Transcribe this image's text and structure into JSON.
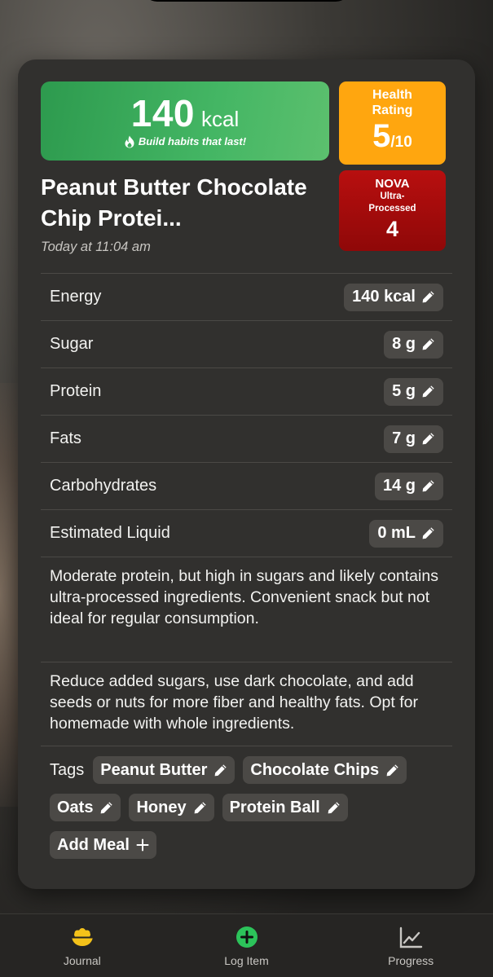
{
  "colors": {
    "kcal_green": "#3aaa5a",
    "health_orange": "#ffa60f",
    "nova_red": "#a00c0c",
    "card_bg": "#31302e",
    "pill_bg": "#4b4946",
    "journal_yellow": "#f4c21a",
    "log_green": "#2cc35a"
  },
  "summary": {
    "kcal_value": "140",
    "kcal_unit": "kcal",
    "tagline": "Build habits that last!",
    "health_title": "Health Rating",
    "health_score": "5",
    "health_denominator": "/10",
    "nova_title": "NOVA",
    "nova_subtitle": "Ultra-Processed",
    "nova_value": "4"
  },
  "food": {
    "title": "Peanut Butter Chocolate Chip Protei...",
    "timestamp": "Today at 11:04 am"
  },
  "nutrients": [
    {
      "label": "Energy",
      "value": "140 kcal"
    },
    {
      "label": "Sugar",
      "value": "8 g"
    },
    {
      "label": "Protein",
      "value": "5 g"
    },
    {
      "label": "Fats",
      "value": "7 g"
    },
    {
      "label": "Carbohydrates",
      "value": "14 g"
    },
    {
      "label": "Estimated Liquid",
      "value": "0 mL"
    }
  ],
  "analysis": "Moderate protein, but high in sugars and likely contains ultra-processed ingredients. Convenient snack but not ideal for regular consumption.",
  "suggestion": "Reduce added sugars, use dark chocolate, and add seeds or nuts for more fiber and healthy fats. Opt for homemade with whole ingredients.",
  "tags": {
    "label": "Tags",
    "items": [
      "Peanut Butter",
      "Chocolate Chips",
      "Oats",
      "Honey",
      "Protein Ball"
    ],
    "add_meal_label": "Add Meal"
  },
  "tabbar": {
    "items": [
      {
        "label": "Journal",
        "icon": "bowl-icon"
      },
      {
        "label": "Log Item",
        "icon": "plus-circle-icon"
      },
      {
        "label": "Progress",
        "icon": "chart-line-icon"
      }
    ]
  }
}
